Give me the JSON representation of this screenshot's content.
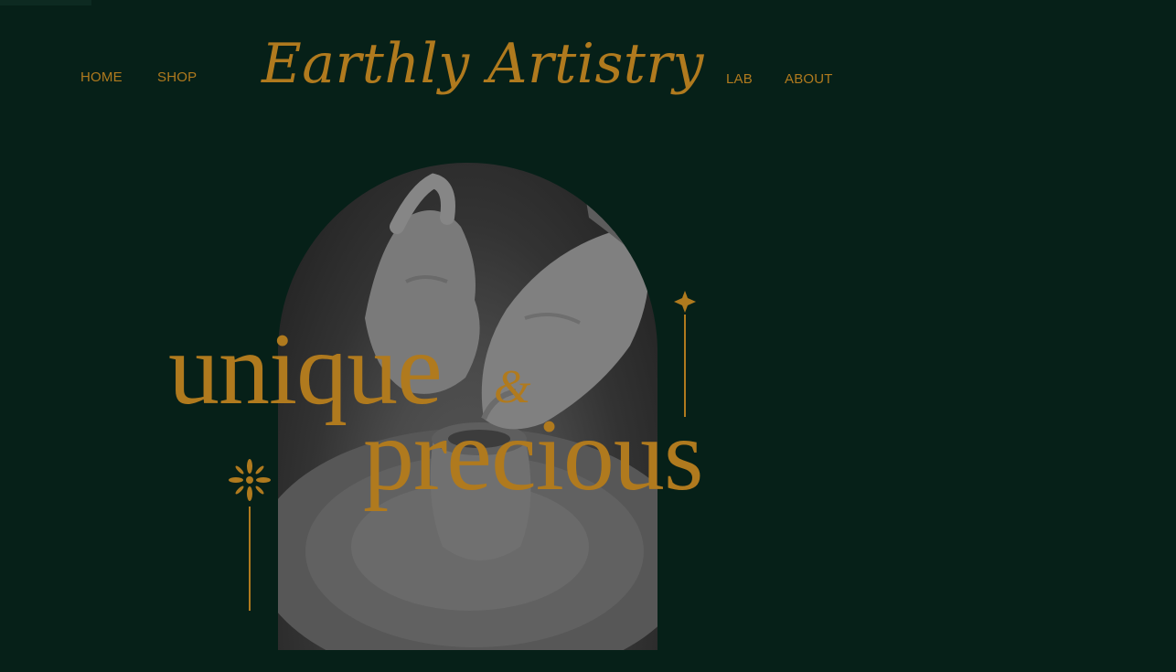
{
  "nav": {
    "home": "HOME",
    "shop": "SHOP",
    "lab": "LAB",
    "about": "ABOUT"
  },
  "brand": {
    "name": "Earthly Artistry"
  },
  "hero": {
    "word_one": "unique",
    "ampersand": "&",
    "word_two": "precious",
    "image_subject": "pottery-wheel-hands-photo"
  },
  "colors": {
    "background": "#062018",
    "accent_gold": "#b07a1e"
  },
  "icons": {
    "ornament_right": "sparkle-star-icon",
    "ornament_left": "flower-star-icon"
  }
}
